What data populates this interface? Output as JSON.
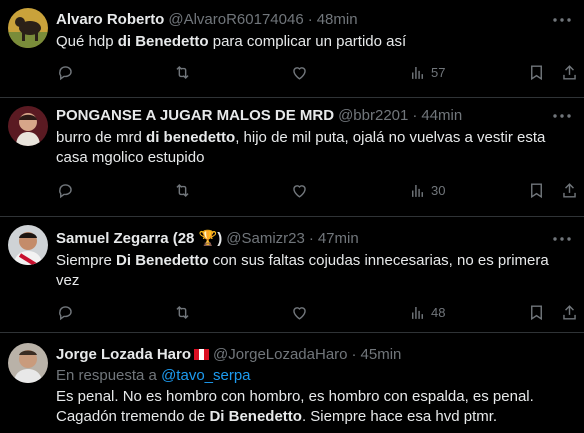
{
  "tweets": [
    {
      "name": "Alvaro Roberto",
      "handle": "@AlvaroR60174046",
      "time": "48min",
      "text_parts": [
        "Qué hdp ",
        "di Benedetto",
        " para complicar un partido así"
      ],
      "views": "57"
    },
    {
      "name": "PONGANSE A JUGAR MALOS DE MRD",
      "handle": "@bbr2201",
      "time": "44min",
      "text_parts": [
        "burro de mrd ",
        "di benedetto",
        ", hijo de mil puta, ojalá no vuelvas a vestir esta casa mgolico estupido"
      ],
      "views": "30"
    },
    {
      "name": "Samuel Zegarra (28 🏆)",
      "handle": "@Samizr23",
      "time": "47min",
      "text_parts": [
        "Siempre ",
        "Di Benedetto",
        " con sus faltas cojudas innecesarias, no es primera vez"
      ],
      "views": "48"
    },
    {
      "name": "Jorge Lozada Haro",
      "handle": "@JorgeLozadaHaro",
      "time": "45min",
      "reply_prefix": "En respuesta a",
      "reply_to": "@tavo_serpa",
      "text_parts": [
        "Es penal. No es hombro con hombro, es hombro con espalda, es penal. Cagadón tremendo de ",
        "Di Benedetto",
        ". Siempre hace esa hvd ptmr."
      ]
    }
  ],
  "icons": {
    "more": "more-horizontal-icon",
    "reply": "reply-icon",
    "retweet": "retweet-icon",
    "like": "heart-icon",
    "views": "views-icon",
    "bookmark": "bookmark-icon",
    "share": "share-icon",
    "flag": "peru-flag-icon"
  },
  "colors": {
    "background": "#000000",
    "text": "#e7e9ea",
    "muted": "#71767b",
    "link": "#1d9bf0",
    "divider": "#2f3336"
  }
}
